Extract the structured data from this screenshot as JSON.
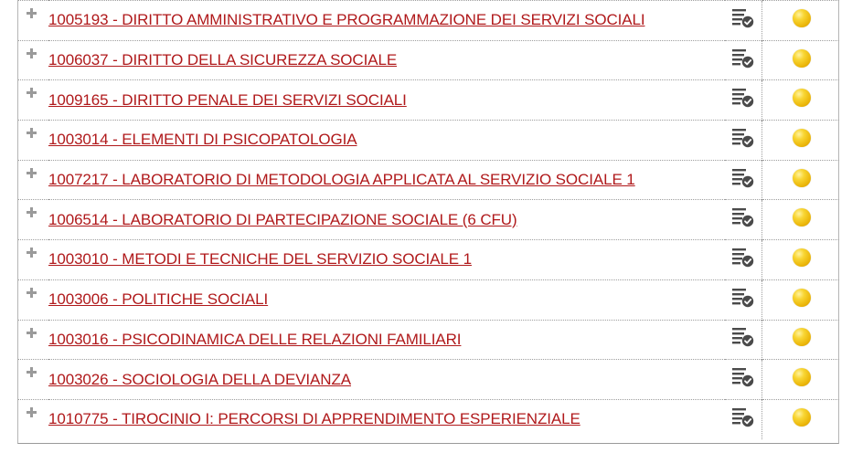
{
  "courses": [
    {
      "label": "1005193 - DIRITTO AMMINISTRATIVO E PROGRAMMAZIONE DEI SERVIZI SOCIALI",
      "status_icon": "yellow-circle-icon",
      "action_icon": "list-check-icon"
    },
    {
      "label": "1006037 - DIRITTO DELLA SICUREZZA SOCIALE",
      "status_icon": "yellow-circle-icon",
      "action_icon": "list-check-icon"
    },
    {
      "label": "1009165 - DIRITTO PENALE DEI SERVIZI SOCIALI",
      "status_icon": "yellow-circle-icon",
      "action_icon": "list-check-icon"
    },
    {
      "label": "1003014 - ELEMENTI DI PSICOPATOLOGIA",
      "status_icon": "yellow-circle-icon",
      "action_icon": "list-check-icon"
    },
    {
      "label": "1007217 - LABORATORIO DI METODOLOGIA APPLICATA AL SERVIZIO SOCIALE 1",
      "status_icon": "yellow-circle-icon",
      "action_icon": "list-check-icon"
    },
    {
      "label": "1006514 - LABORATORIO DI PARTECIPAZIONE SOCIALE (6 CFU)",
      "status_icon": "yellow-circle-icon",
      "action_icon": "list-check-icon"
    },
    {
      "label": "1003010 - METODI E TECNICHE DEL SERVIZIO SOCIALE 1",
      "status_icon": "yellow-circle-icon",
      "action_icon": "list-check-icon"
    },
    {
      "label": "1003006 - POLITICHE SOCIALI",
      "status_icon": "yellow-circle-icon",
      "action_icon": "list-check-icon"
    },
    {
      "label": "1003016 - PSICODINAMICA DELLE RELAZIONI FAMILIARI",
      "status_icon": "yellow-circle-icon",
      "action_icon": "list-check-icon"
    },
    {
      "label": "1003026 - SOCIOLOGIA DELLA DEVIANZA",
      "status_icon": "yellow-circle-icon",
      "action_icon": "list-check-icon"
    },
    {
      "label": "1010775 - TIROCINIO I: PERCORSI DI APPRENDIMENTO ESPERIENZIALE",
      "status_icon": "yellow-circle-icon",
      "action_icon": "list-check-icon"
    }
  ],
  "colors": {
    "link": "#b0191b",
    "status": "#f2c318",
    "icon": "#4a4a4a",
    "border": "#9e9e9e"
  }
}
